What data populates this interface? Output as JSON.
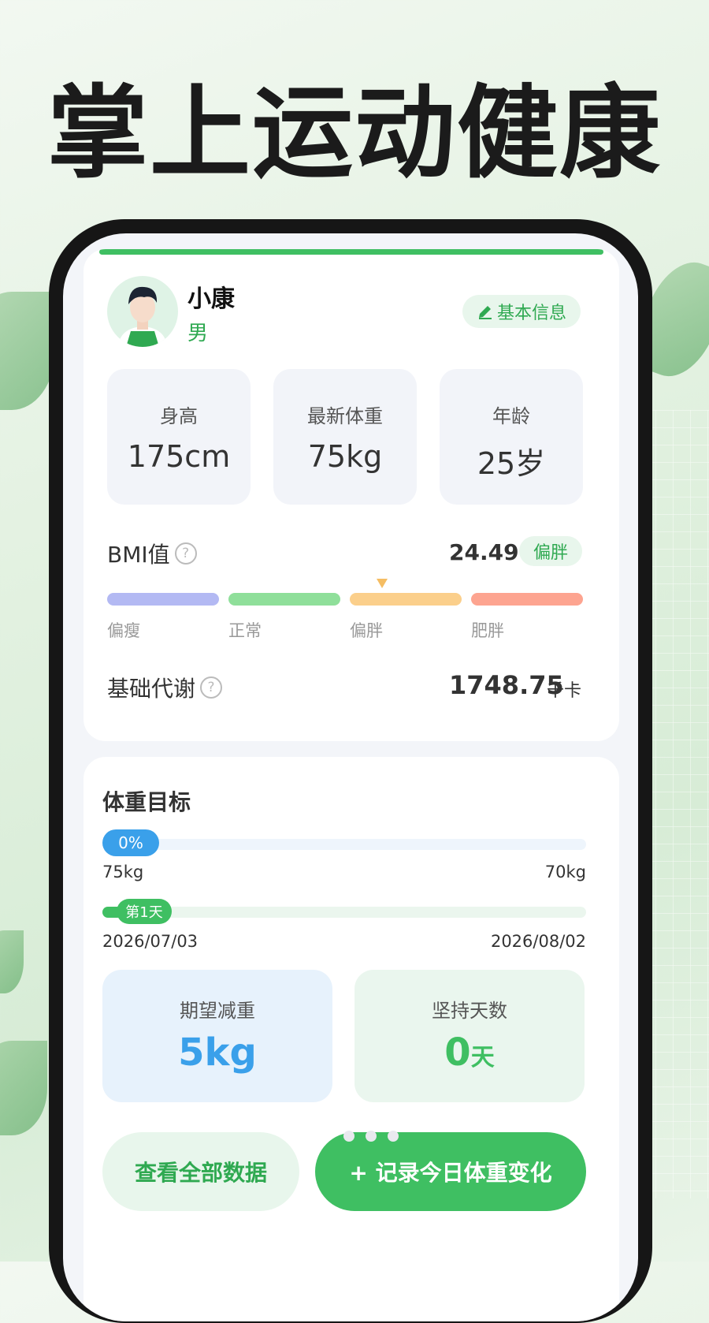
{
  "headline": "掌上运动健康",
  "profile": {
    "name": "小康",
    "gender": "男",
    "info_button": "基本信息"
  },
  "stats": [
    {
      "label": "身高",
      "value": "175cm"
    },
    {
      "label": "最新体重",
      "value": "75kg"
    },
    {
      "label": "年龄",
      "value": "25岁"
    }
  ],
  "bmi": {
    "label": "BMI值",
    "value": "24.49",
    "status": "偏胖",
    "categories": [
      "偏瘦",
      "正常",
      "偏胖",
      "肥胖"
    ],
    "colors": [
      "#b3b9f3",
      "#8fdf9a",
      "#fbcf8b",
      "#fda490"
    ]
  },
  "bmr": {
    "label": "基础代谢",
    "value": "1748.75",
    "unit": "千卡"
  },
  "goal": {
    "title": "体重目标",
    "weight_progress": "0%",
    "weight_progress_fraction": 0,
    "start_weight": "75kg",
    "target_weight": "70kg",
    "day_label": "第1天",
    "start_date": "2026/07/03",
    "end_date": "2026/08/02",
    "expected_loss_label": "期望减重",
    "expected_loss_value": "5kg",
    "streak_label": "坚持天数",
    "streak_value": "0",
    "streak_unit": "天"
  },
  "buttons": {
    "view_all": "查看全部数据",
    "record": "+ 记录今日体重变化"
  },
  "colors": {
    "accent_green": "#3fbf62",
    "accent_blue": "#3aa0ea"
  }
}
